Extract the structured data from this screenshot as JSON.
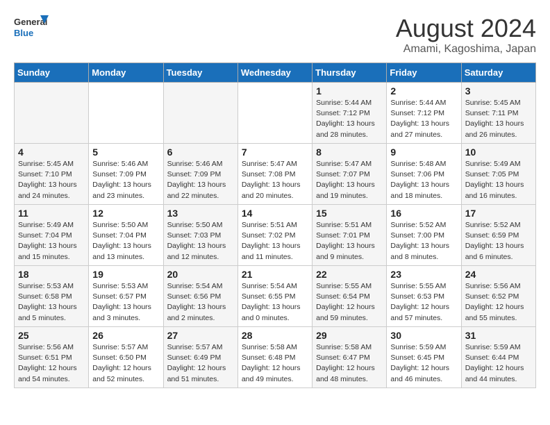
{
  "header": {
    "logo_line1": "General",
    "logo_line2": "Blue",
    "title": "August 2024",
    "subtitle": "Amami, Kagoshima, Japan"
  },
  "weekdays": [
    "Sunday",
    "Monday",
    "Tuesday",
    "Wednesday",
    "Thursday",
    "Friday",
    "Saturday"
  ],
  "weeks": [
    [
      {
        "day": "",
        "info": ""
      },
      {
        "day": "",
        "info": ""
      },
      {
        "day": "",
        "info": ""
      },
      {
        "day": "",
        "info": ""
      },
      {
        "day": "1",
        "info": "Sunrise: 5:44 AM\nSunset: 7:12 PM\nDaylight: 13 hours\nand 28 minutes."
      },
      {
        "day": "2",
        "info": "Sunrise: 5:44 AM\nSunset: 7:12 PM\nDaylight: 13 hours\nand 27 minutes."
      },
      {
        "day": "3",
        "info": "Sunrise: 5:45 AM\nSunset: 7:11 PM\nDaylight: 13 hours\nand 26 minutes."
      }
    ],
    [
      {
        "day": "4",
        "info": "Sunrise: 5:45 AM\nSunset: 7:10 PM\nDaylight: 13 hours\nand 24 minutes."
      },
      {
        "day": "5",
        "info": "Sunrise: 5:46 AM\nSunset: 7:09 PM\nDaylight: 13 hours\nand 23 minutes."
      },
      {
        "day": "6",
        "info": "Sunrise: 5:46 AM\nSunset: 7:09 PM\nDaylight: 13 hours\nand 22 minutes."
      },
      {
        "day": "7",
        "info": "Sunrise: 5:47 AM\nSunset: 7:08 PM\nDaylight: 13 hours\nand 20 minutes."
      },
      {
        "day": "8",
        "info": "Sunrise: 5:47 AM\nSunset: 7:07 PM\nDaylight: 13 hours\nand 19 minutes."
      },
      {
        "day": "9",
        "info": "Sunrise: 5:48 AM\nSunset: 7:06 PM\nDaylight: 13 hours\nand 18 minutes."
      },
      {
        "day": "10",
        "info": "Sunrise: 5:49 AM\nSunset: 7:05 PM\nDaylight: 13 hours\nand 16 minutes."
      }
    ],
    [
      {
        "day": "11",
        "info": "Sunrise: 5:49 AM\nSunset: 7:04 PM\nDaylight: 13 hours\nand 15 minutes."
      },
      {
        "day": "12",
        "info": "Sunrise: 5:50 AM\nSunset: 7:04 PM\nDaylight: 13 hours\nand 13 minutes."
      },
      {
        "day": "13",
        "info": "Sunrise: 5:50 AM\nSunset: 7:03 PM\nDaylight: 13 hours\nand 12 minutes."
      },
      {
        "day": "14",
        "info": "Sunrise: 5:51 AM\nSunset: 7:02 PM\nDaylight: 13 hours\nand 11 minutes."
      },
      {
        "day": "15",
        "info": "Sunrise: 5:51 AM\nSunset: 7:01 PM\nDaylight: 13 hours\nand 9 minutes."
      },
      {
        "day": "16",
        "info": "Sunrise: 5:52 AM\nSunset: 7:00 PM\nDaylight: 13 hours\nand 8 minutes."
      },
      {
        "day": "17",
        "info": "Sunrise: 5:52 AM\nSunset: 6:59 PM\nDaylight: 13 hours\nand 6 minutes."
      }
    ],
    [
      {
        "day": "18",
        "info": "Sunrise: 5:53 AM\nSunset: 6:58 PM\nDaylight: 13 hours\nand 5 minutes."
      },
      {
        "day": "19",
        "info": "Sunrise: 5:53 AM\nSunset: 6:57 PM\nDaylight: 13 hours\nand 3 minutes."
      },
      {
        "day": "20",
        "info": "Sunrise: 5:54 AM\nSunset: 6:56 PM\nDaylight: 13 hours\nand 2 minutes."
      },
      {
        "day": "21",
        "info": "Sunrise: 5:54 AM\nSunset: 6:55 PM\nDaylight: 13 hours\nand 0 minutes."
      },
      {
        "day": "22",
        "info": "Sunrise: 5:55 AM\nSunset: 6:54 PM\nDaylight: 12 hours\nand 59 minutes."
      },
      {
        "day": "23",
        "info": "Sunrise: 5:55 AM\nSunset: 6:53 PM\nDaylight: 12 hours\nand 57 minutes."
      },
      {
        "day": "24",
        "info": "Sunrise: 5:56 AM\nSunset: 6:52 PM\nDaylight: 12 hours\nand 55 minutes."
      }
    ],
    [
      {
        "day": "25",
        "info": "Sunrise: 5:56 AM\nSunset: 6:51 PM\nDaylight: 12 hours\nand 54 minutes."
      },
      {
        "day": "26",
        "info": "Sunrise: 5:57 AM\nSunset: 6:50 PM\nDaylight: 12 hours\nand 52 minutes."
      },
      {
        "day": "27",
        "info": "Sunrise: 5:57 AM\nSunset: 6:49 PM\nDaylight: 12 hours\nand 51 minutes."
      },
      {
        "day": "28",
        "info": "Sunrise: 5:58 AM\nSunset: 6:48 PM\nDaylight: 12 hours\nand 49 minutes."
      },
      {
        "day": "29",
        "info": "Sunrise: 5:58 AM\nSunset: 6:47 PM\nDaylight: 12 hours\nand 48 minutes."
      },
      {
        "day": "30",
        "info": "Sunrise: 5:59 AM\nSunset: 6:45 PM\nDaylight: 12 hours\nand 46 minutes."
      },
      {
        "day": "31",
        "info": "Sunrise: 5:59 AM\nSunset: 6:44 PM\nDaylight: 12 hours\nand 44 minutes."
      }
    ]
  ]
}
